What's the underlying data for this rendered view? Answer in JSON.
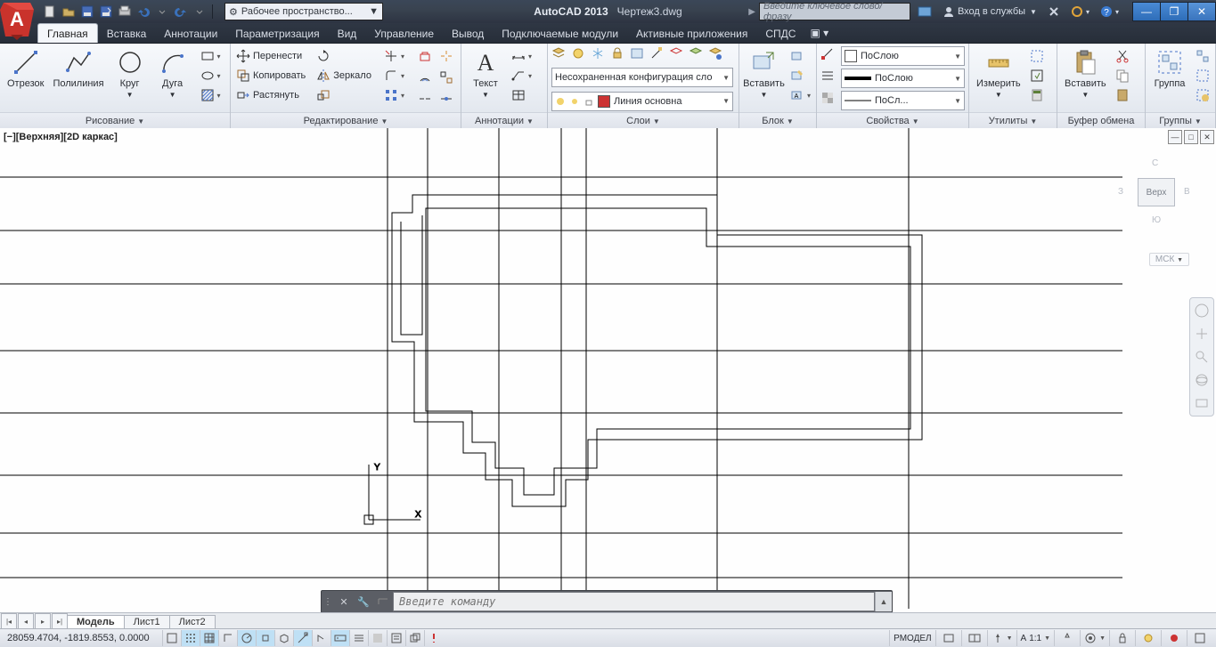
{
  "title": {
    "app": "AutoCAD 2013",
    "file": "Чертеж3.dwg"
  },
  "workspace_label": "Рабочее пространство...",
  "search_placeholder": "Введите ключевое слово/фразу",
  "signin_label": "Вход в службы",
  "menu_tabs": [
    "Главная",
    "Вставка",
    "Аннотации",
    "Параметризация",
    "Вид",
    "Управление",
    "Вывод",
    "Подключаемые модули",
    "Активные приложения",
    "СПДС"
  ],
  "active_tab": 0,
  "panels": {
    "draw": {
      "title": "Рисование",
      "items": {
        "line": "Отрезок",
        "polyline": "Полилиния",
        "circle": "Круг",
        "arc": "Дуга"
      }
    },
    "modify": {
      "title": "Редактирование",
      "items": {
        "move": "Перенести",
        "copy": "Копировать",
        "stretch": "Растянуть",
        "mirror": "Зеркало"
      }
    },
    "annot": {
      "title": "Аннотации",
      "text": "Текст"
    },
    "layers": {
      "title": "Слои",
      "unsaved": "Несохраненная конфигурация сло",
      "current": "Линия основна"
    },
    "block": {
      "title": "Блок",
      "insert": "Вставить"
    },
    "props": {
      "title": "Свойства",
      "color": "ПоСлою",
      "ltype": "ПоСлою",
      "lweight": "ПоСл..."
    },
    "utils": {
      "title": "Утилиты",
      "measure": "Измерить"
    },
    "clip": {
      "title": "Буфер обмена",
      "paste": "Вставить"
    },
    "groups": {
      "title": "Группы",
      "group": "Группа"
    }
  },
  "viewport_label": "[−][Верхняя][2D каркас]",
  "viewcube": {
    "face": "Верх",
    "n": "С",
    "s": "Ю",
    "e": "В",
    "w": "З"
  },
  "wcs_label": "МСК",
  "command_placeholder": "Введите команду",
  "layout_tabs": [
    "Модель",
    "Лист1",
    "Лист2"
  ],
  "active_layout": 0,
  "coords": "28059.4704, -1819.8553, 0.0000",
  "status_right": {
    "space": "РМОДЕЛ",
    "scale": "1:1"
  }
}
